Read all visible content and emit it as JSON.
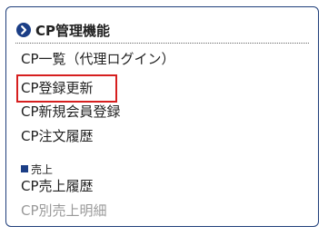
{
  "panel": {
    "title": "CP管理機能",
    "header_icon": "chevron-right-circle-icon",
    "accent_color": "#1b3e86",
    "highlight_color": "#d61f1f"
  },
  "menu": {
    "items": [
      {
        "label": "CP一覧（代理ログイン）"
      },
      {
        "label": "CP登録更新"
      },
      {
        "label": "CP新規会員登録"
      },
      {
        "label": "CP注文履歴"
      }
    ]
  },
  "sales_section": {
    "label": "売上",
    "items": [
      {
        "label": "CP売上履歴"
      },
      {
        "label": "CP別売上明細"
      }
    ]
  }
}
